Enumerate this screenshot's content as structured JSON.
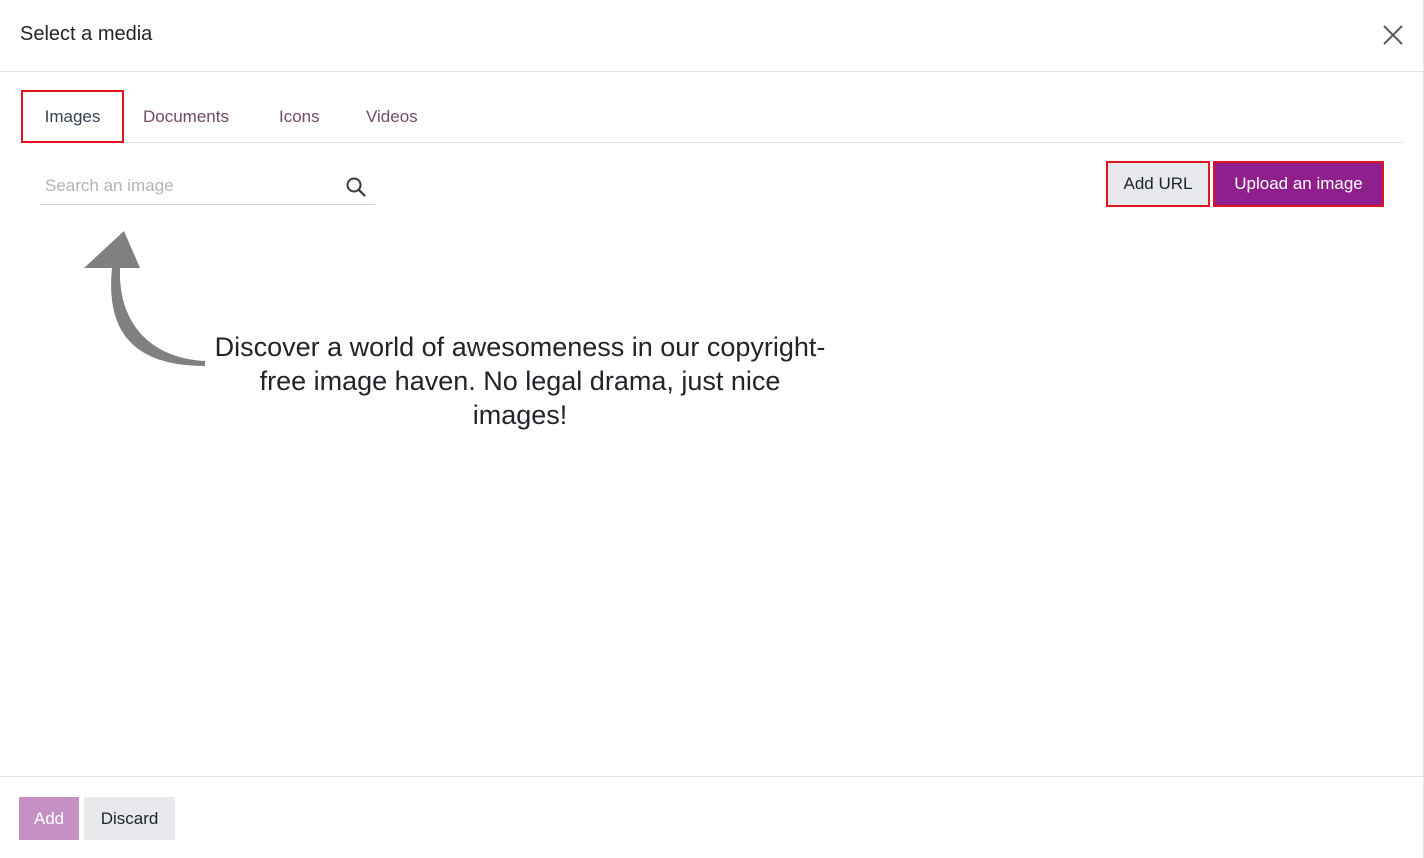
{
  "dialog": {
    "title": "Select a media",
    "close_icon": "close-icon"
  },
  "tabs": [
    {
      "label": "Images",
      "active": true
    },
    {
      "label": "Documents",
      "active": false
    },
    {
      "label": "Icons",
      "active": false
    },
    {
      "label": "Videos",
      "active": false
    }
  ],
  "search": {
    "placeholder": "Search an image",
    "value": "",
    "icon": "search-icon"
  },
  "toolbar": {
    "add_url_label": "Add URL",
    "upload_label": "Upload an image"
  },
  "empty_state": {
    "message": "Discover a world of awesomeness in our copyright-free image haven. No legal drama, just nice images!",
    "arrow_icon": "curved-arrow-icon"
  },
  "footer": {
    "add_label": "Add",
    "discard_label": "Discard"
  },
  "colors": {
    "primary": "#8f1f8c",
    "primary_disabled": "#c790c4",
    "tab_link": "#714b67",
    "secondary_bg": "#e7e9ed",
    "highlight_border": "#e0141e",
    "arrow": "#808080"
  }
}
